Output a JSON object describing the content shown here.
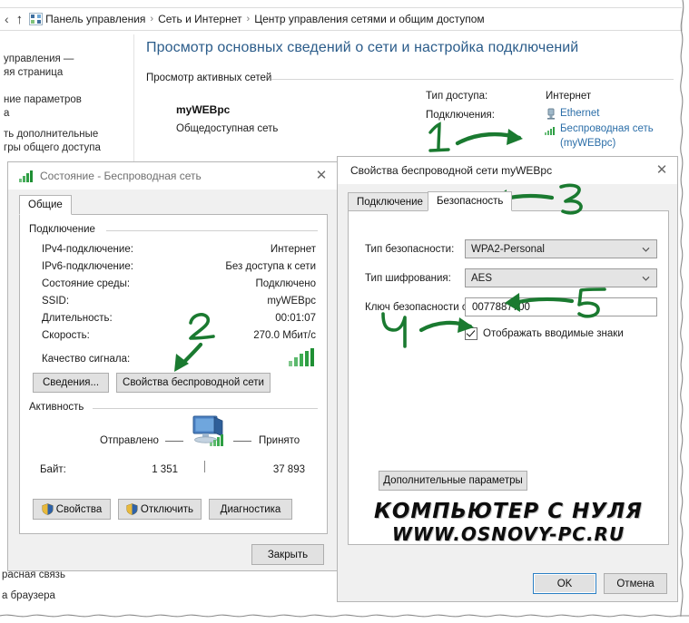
{
  "explorer": {
    "nav": {
      "back_icon": "chevron-left-icon",
      "up_icon": "arrow-up-icon",
      "control_panel_icon": "control-panel-icon"
    },
    "breadcrumb": [
      "Панель управления",
      "Сеть и Интернет",
      "Центр управления сетями и общим доступом"
    ],
    "breadcrumb_separator": "›",
    "page_title": "Просмотр основных сведений о сети и настройка подключений",
    "section_label": "Просмотр активных сетей",
    "sidebar_links": [
      "управления —",
      "яя страница",
      "ние параметров",
      "а",
      "ть дополнительные",
      "гры общего доступа"
    ],
    "network": {
      "name": "myWEBpc",
      "type": "Общедоступная сеть"
    },
    "access": {
      "access_type_label": "Тип доступа:",
      "access_type_value": "Интернет",
      "connections_label": "Подключения:",
      "ethernet_link": "Ethernet",
      "wireless_link": "Беспроводная сеть",
      "wireless_link_second": "(myWEBpc)"
    },
    "background_notes": [
      "расная связь",
      "а браузера"
    ]
  },
  "status_dialog": {
    "title": "Состояние - Беспроводная сеть",
    "title_icon": "wifi-signal-icon",
    "close_label": "✕",
    "tabs": [
      "Общие"
    ],
    "active_tab": "Общие",
    "connection_group_label": "Подключение",
    "connection_rows": [
      {
        "label": "IPv4-подключение:",
        "value": "Интернет"
      },
      {
        "label": "IPv6-подключение:",
        "value": "Без доступа к сети"
      },
      {
        "label": "Состояние среды:",
        "value": "Подключено"
      },
      {
        "label": "SSID:",
        "value": "myWEBpc"
      },
      {
        "label": "Длительность:",
        "value": "00:01:07"
      },
      {
        "label": "Скорость:",
        "value": "270.0 Мбит/с"
      },
      {
        "label": "Качество сигнала:",
        "value": ""
      }
    ],
    "signal_icon": "signal-bars-icon",
    "details_button": "Сведения...",
    "wireless_props_button": "Свойства беспроводной сети",
    "activity_group_label": "Активность",
    "activity": {
      "sent_label": "Отправлено",
      "received_label": "Принято",
      "computer_icon": "computer-network-icon",
      "bytes_label": "Байт:",
      "sent_value": "1 351",
      "received_value": "37 893"
    },
    "buttons": {
      "properties": "Свойства",
      "disable": "Отключить",
      "diagnose": "Диагностика",
      "close": "Закрыть"
    },
    "shield_icon": "uac-shield-icon"
  },
  "props_dialog": {
    "title": "Свойства беспроводной сети myWEBpc",
    "close_label": "✕",
    "tabs": [
      "Подключение",
      "Безопасность"
    ],
    "active_tab": "Безопасность",
    "fields": {
      "security_type_label": "Тип безопасности:",
      "security_type_value": "WPA2-Personal",
      "encryption_type_label": "Тип шифрования:",
      "encryption_type_value": "AES",
      "key_label": "Ключ безопасности сети",
      "key_value": "0077887700",
      "show_chars_label": "Отображать вводимые знаки",
      "show_chars_checked": true
    },
    "advanced_button": "Дополнительные параметры",
    "buttons": {
      "ok": "OK",
      "cancel": "Отмена"
    },
    "dropdown_icon": "chevron-down-icon"
  },
  "annotations": {
    "color": "#1a7a30",
    "steps": [
      {
        "id": "step-1",
        "label": "1"
      },
      {
        "id": "step-2",
        "label": "2"
      },
      {
        "id": "step-3",
        "label": "3"
      },
      {
        "id": "step-4",
        "label": "4"
      },
      {
        "id": "step-5",
        "label": "5"
      }
    ]
  },
  "watermark": {
    "line1": "КОМПЬЮТЕР С НУЛЯ",
    "line2": "WWW.OSNOVY-PC.RU"
  }
}
